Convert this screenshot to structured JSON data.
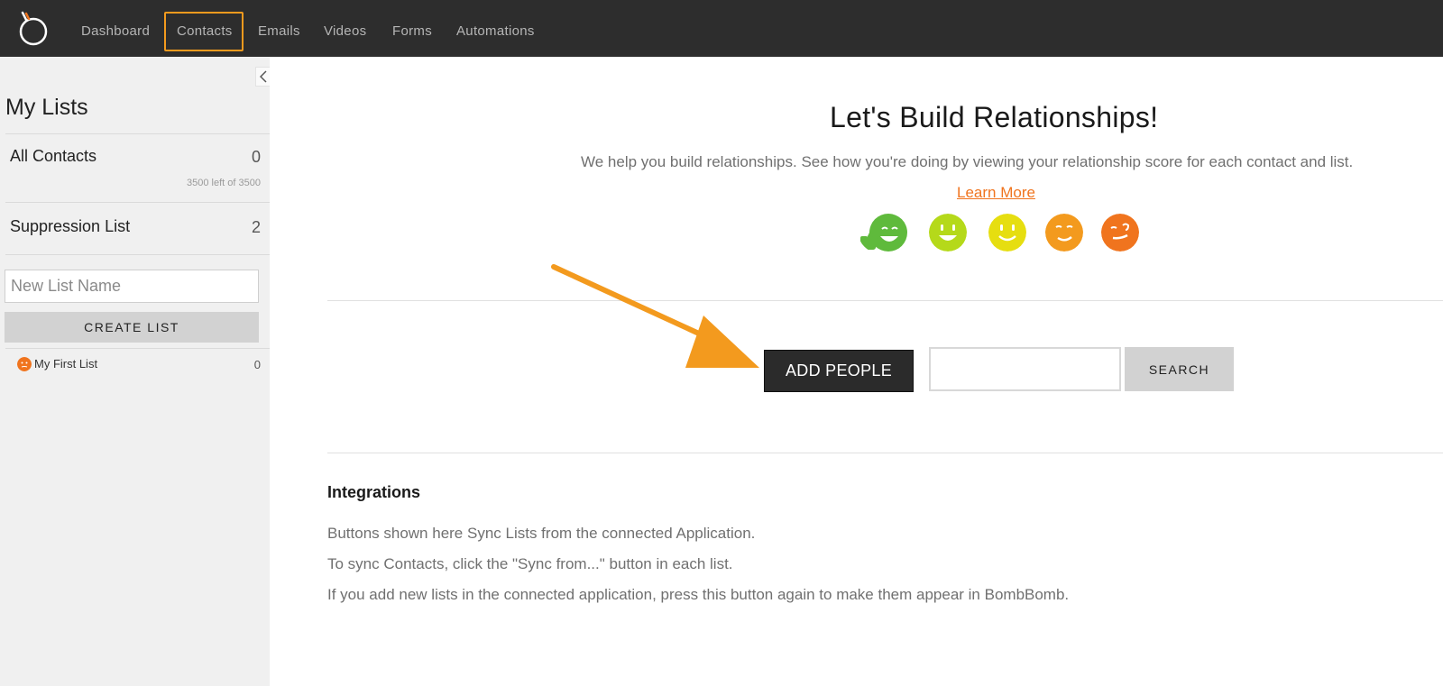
{
  "nav": {
    "items": [
      {
        "label": "Dashboard"
      },
      {
        "label": "Contacts"
      },
      {
        "label": "Emails"
      },
      {
        "label": "Videos"
      },
      {
        "label": "Forms"
      },
      {
        "label": "Automations"
      }
    ],
    "active": "Contacts"
  },
  "sidebar": {
    "title": "My Lists",
    "all_contacts": {
      "label": "All Contacts",
      "count": "0",
      "sub": "3500 left of 3500"
    },
    "suppression": {
      "label": "Suppression List",
      "count": "2"
    },
    "new_list_placeholder": "New List Name",
    "create_label": "CREATE LIST",
    "lists": [
      {
        "name": "My First List",
        "count": "0"
      }
    ]
  },
  "main": {
    "title": "Let's Build Relationships!",
    "description": "We help you build relationships. See how you're doing by viewing your relationship score for each contact and list.",
    "learn_more": "Learn More",
    "add_label": "ADD PEOPLE",
    "search_label": "SEARCH",
    "search_value": ""
  },
  "integrations": {
    "title": "Integrations",
    "lines": [
      "Buttons shown here Sync Lists from the connected Application.",
      "To sync Contacts, click the \"Sync from...\" button in each list.",
      "If you add new lists in the connected application, press this button again to make them appear in BombBomb."
    ]
  },
  "colors": {
    "accent": "#f39a1e",
    "link": "#f0741e",
    "face_green": "#5fba3c",
    "face_lime": "#b5d91a",
    "face_yellow": "#e6de10",
    "face_orange": "#f39a1e",
    "face_red": "#f0741e"
  }
}
